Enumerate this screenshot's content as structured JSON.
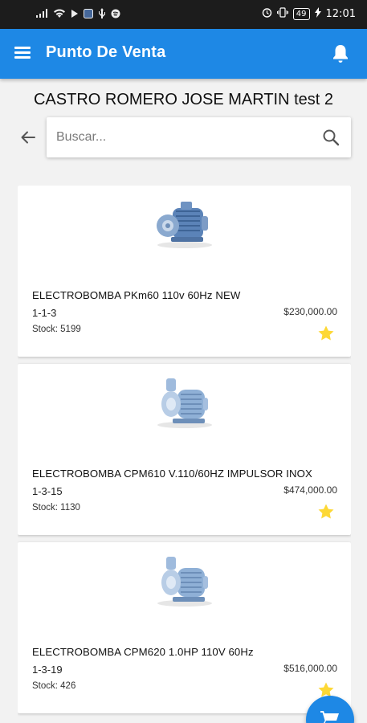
{
  "status_bar": {
    "time": "12:01",
    "battery": "49",
    "left_icons": [
      "signal-icon",
      "wifi-icon",
      "play-icon",
      "app-icon",
      "usb-icon",
      "spotify-icon"
    ],
    "right_icons": [
      "alarm-icon",
      "vibrate-icon",
      "battery-icon"
    ]
  },
  "app_bar": {
    "title": "Punto De Venta",
    "menu_icon": "menu-icon",
    "notification_icon": "bell-icon",
    "color": "#1e88e5"
  },
  "client": {
    "name": "CASTRO ROMERO JOSE MARTIN test 2"
  },
  "search": {
    "placeholder": "Buscar...",
    "value": ""
  },
  "products": [
    {
      "name": "ELECTROBOMBA PKm60 110v 60Hz NEW",
      "code": "1-1-3",
      "price": "$230,000.00",
      "stock": "Stock: 5199",
      "image": "pump-icon",
      "favorite": true
    },
    {
      "name": "ELECTROBOMBA CPM610 V.110/60HZ IMPULSOR INOX",
      "code": "1-3-15",
      "price": "$474,000.00",
      "stock": "Stock: 1130",
      "image": "pump-icon",
      "favorite": true
    },
    {
      "name": "ELECTROBOMBA CPM620 1.0HP 110V 60Hz",
      "code": "1-3-19",
      "price": "$516,000.00",
      "stock": "Stock: 426",
      "image": "pump-icon",
      "favorite": true
    }
  ],
  "fab": {
    "icon": "cart-icon",
    "color": "#1e88e5"
  },
  "colors": {
    "accent": "#1e88e5",
    "star": "#fdd835"
  }
}
